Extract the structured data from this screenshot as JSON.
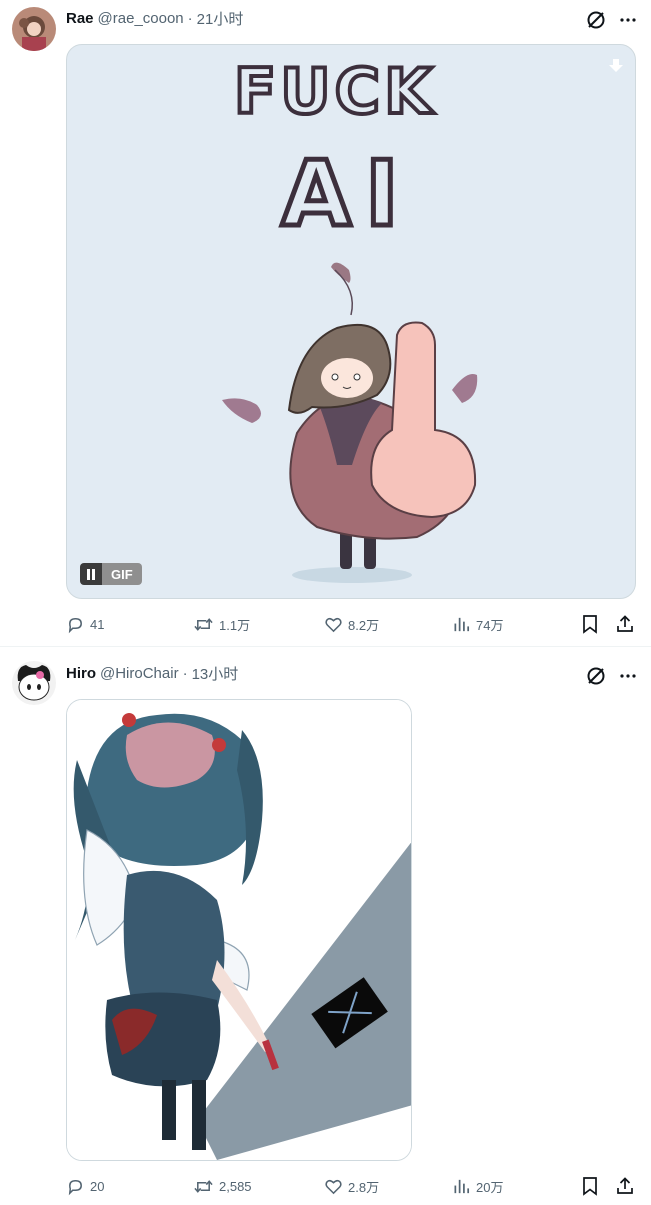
{
  "tweets": [
    {
      "name": "Rae",
      "handle": "@rae_cooon",
      "time": "21小时",
      "media_type": "gif",
      "media_text": {
        "line1": "FUCK",
        "line2": "AI"
      },
      "gif_label": "GIF",
      "stats": {
        "replies": "41",
        "retweets": "1.1万",
        "likes": "8.2万",
        "views": "74万"
      }
    },
    {
      "name": "Hiro",
      "handle": "@HiroChair",
      "time": "13小时",
      "media_type": "image",
      "stats": {
        "replies": "20",
        "retweets": "2,585",
        "likes": "2.8万",
        "views": "20万"
      }
    }
  ],
  "separator": "·",
  "colors": {
    "text_primary": "#0f1419",
    "text_secondary": "#536471",
    "border": "#cfd9de",
    "gif_bg": "#e2ebf3"
  }
}
